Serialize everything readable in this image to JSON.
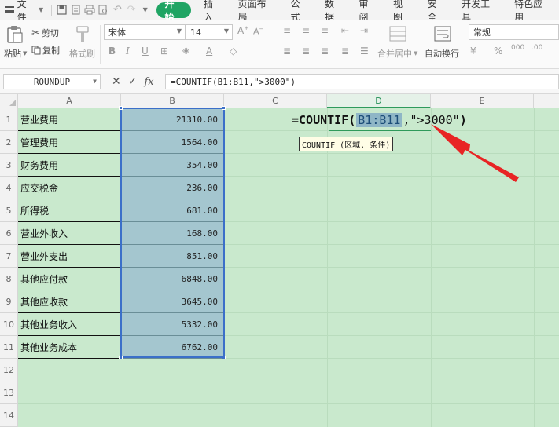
{
  "menubar": {
    "file_label": "文件",
    "tabs": [
      {
        "label": "开始",
        "active": true
      },
      {
        "label": "插入"
      },
      {
        "label": "页面布局"
      },
      {
        "label": "公式"
      },
      {
        "label": "数据"
      },
      {
        "label": "审阅"
      },
      {
        "label": "视图"
      },
      {
        "label": "安全"
      },
      {
        "label": "开发工具"
      },
      {
        "label": "特色应用"
      }
    ]
  },
  "ribbon": {
    "paste_label": "粘贴",
    "cut_label": "剪切",
    "copy_label": "复制",
    "format_painter_label": "格式刷",
    "font_name": "宋体",
    "font_size": "14",
    "merge_label": "合并居中",
    "wrap_label": "自动换行",
    "number_format": "常规"
  },
  "formula_bar": {
    "name_box": "ROUNDUP",
    "formula": "=COUNTIF(B1:B11,\">3000\")",
    "fx_label": "fx"
  },
  "grid": {
    "columns": [
      "A",
      "B",
      "C",
      "D",
      "E"
    ],
    "rows": [
      "1",
      "2",
      "3",
      "4",
      "5",
      "6",
      "7",
      "8",
      "9",
      "10",
      "11",
      "12",
      "13",
      "14"
    ],
    "data": [
      {
        "label": "营业费用",
        "value": "21310.00"
      },
      {
        "label": "管理费用",
        "value": "1564.00"
      },
      {
        "label": "财务费用",
        "value": "354.00"
      },
      {
        "label": "应交税金",
        "value": "236.00"
      },
      {
        "label": "所得税",
        "value": "681.00"
      },
      {
        "label": "营业外收入",
        "value": "168.00"
      },
      {
        "label": "营业外支出",
        "value": "851.00"
      },
      {
        "label": "其他应付款",
        "value": "6848.00"
      },
      {
        "label": "其他应收款",
        "value": "3645.00"
      },
      {
        "label": "其他业务收入",
        "value": "5332.00"
      },
      {
        "label": "其他业务成本",
        "value": "6762.00"
      }
    ],
    "edit_cell": {
      "prefix": "=COUNTIF(",
      "range": "B1:B11",
      "comma": ",",
      "criteria": "\">3000\"",
      "suffix": ")"
    },
    "tooltip": "COUNTIF (区域, 条件)"
  },
  "colors": {
    "accent_green": "#1fa463",
    "sheet_bg": "#c9e9cd",
    "selection_fill": "#a4c6cf",
    "selection_border": "#3b6fc9",
    "arrow_red": "#e82424"
  }
}
